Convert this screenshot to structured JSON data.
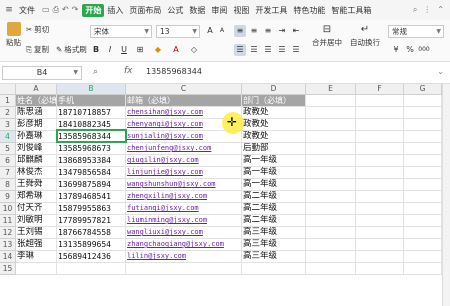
{
  "menu": {
    "file": "文件",
    "items": [
      "开始",
      "插入",
      "页面布局",
      "公式",
      "数据",
      "审阅",
      "视图",
      "开发工具",
      "特色功能",
      "智能工具箱"
    ],
    "active_index": 0
  },
  "ribbon": {
    "paste": "粘贴",
    "cut": "剪切",
    "copy": "复制",
    "format_painter": "格式刷",
    "font_name": "宋体",
    "font_size": "13",
    "merge_center": "合并居中",
    "wrap_text": "自动换行",
    "number_format": "常规"
  },
  "formula_bar": {
    "name_box": "B4",
    "fx": "fx",
    "value": "13585968344"
  },
  "columns": [
    "A",
    "B",
    "C",
    "D",
    "E",
    "F",
    "G"
  ],
  "rows": [
    "1",
    "2",
    "3",
    "4",
    "5",
    "6",
    "7",
    "8",
    "9",
    "10",
    "11",
    "12",
    "13",
    "14",
    "15"
  ],
  "headers": {
    "name": "姓名（必填）",
    "phone": "手机",
    "email": "邮箱（必填）",
    "dept": "部门（必填）"
  },
  "records": [
    {
      "name": "陈思涵",
      "phone": "18710718857",
      "email": "chensihan@jsxy.com",
      "dept": "政教处"
    },
    {
      "name": "彭彦期",
      "phone": "18410882345",
      "email": "chenyanqi@jsxy.com",
      "dept": "政教处"
    },
    {
      "name": "孙嘉琳",
      "phone": "13585968344",
      "email": "sunjialin@jsxy.com",
      "dept": "政教处"
    },
    {
      "name": "刘俊峰",
      "phone": "13585968673",
      "email": "chenjunfeng@jsxy.com",
      "dept": "后勤部"
    },
    {
      "name": "邱麒麟",
      "phone": "13868953384",
      "email": "qiuqilin@jsxy.com",
      "dept": "高一年级"
    },
    {
      "name": "林俊杰",
      "phone": "13479856584",
      "email": "linjunjie@jsxy.com",
      "dept": "高一年级"
    },
    {
      "name": "王舜舜",
      "phone": "13699875894",
      "email": "wangshunshun@jsxy.com",
      "dept": "高一年级"
    },
    {
      "name": "郑希琳",
      "phone": "13789468541",
      "email": "zhengxilin@jsxy.com",
      "dept": "高二年级"
    },
    {
      "name": "付天齐",
      "phone": "15879955863",
      "email": "futianqi@jsxy.com",
      "dept": "高二年级"
    },
    {
      "name": "刘敏明",
      "phone": "17789957821",
      "email": "liuminming@jsxy.com",
      "dept": "高二年级"
    },
    {
      "name": "王刘锡",
      "phone": "18766784558",
      "email": "wangliuxi@jsxy.com",
      "dept": "高三年级"
    },
    {
      "name": "张超强",
      "phone": "13135899654",
      "email": "zhangchaoqiang@jsxy.com",
      "dept": "高三年级"
    },
    {
      "name": "李琳",
      "phone": "15689412436",
      "email": "lilin@jsxy.com",
      "dept": "高三年级"
    }
  ],
  "colors": {
    "accent": "#2ea84e",
    "header_fill": "#a5a5a5",
    "link": "#6b1fae"
  }
}
